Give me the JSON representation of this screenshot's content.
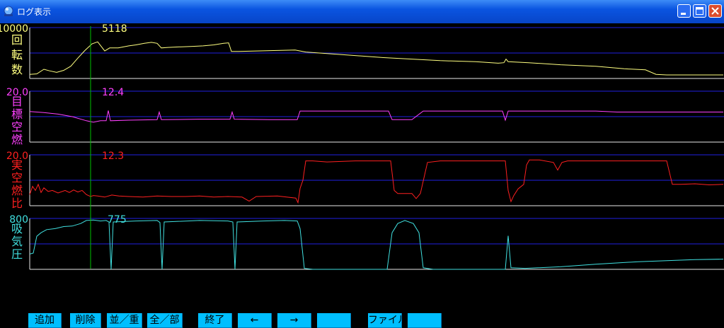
{
  "window": {
    "title": "ログ表示",
    "controls": [
      "minimize",
      "maximize",
      "close"
    ]
  },
  "panels": [
    {
      "max_label": "10000",
      "caption": [
        "回",
        "転",
        "数"
      ],
      "cursor_value": "5118",
      "color": "#ffff80",
      "data": [
        [
          0,
          8
        ],
        [
          10,
          9
        ],
        [
          20,
          18
        ],
        [
          28,
          15
        ],
        [
          38,
          12
        ],
        [
          48,
          16
        ],
        [
          58,
          24
        ],
        [
          68,
          40
        ],
        [
          78,
          55
        ],
        [
          88,
          68
        ],
        [
          96,
          72
        ],
        [
          106,
          54
        ],
        [
          113,
          60
        ],
        [
          125,
          60
        ],
        [
          140,
          64
        ],
        [
          150,
          66
        ],
        [
          162,
          69
        ],
        [
          172,
          71
        ],
        [
          180,
          69
        ],
        [
          186,
          60
        ],
        [
          195,
          61
        ],
        [
          210,
          62
        ],
        [
          230,
          63
        ],
        [
          245,
          64
        ],
        [
          260,
          66
        ],
        [
          274,
          69
        ],
        [
          281,
          70
        ],
        [
          285,
          53
        ],
        [
          295,
          53
        ],
        [
          320,
          54
        ],
        [
          350,
          55
        ],
        [
          375,
          56
        ],
        [
          390,
          52
        ],
        [
          420,
          49
        ],
        [
          460,
          45
        ],
        [
          500,
          41
        ],
        [
          540,
          38
        ],
        [
          580,
          35
        ],
        [
          630,
          33
        ],
        [
          662,
          30
        ],
        [
          670,
          31
        ],
        [
          673,
          38
        ],
        [
          676,
          33
        ],
        [
          705,
          31
        ],
        [
          750,
          27
        ],
        [
          800,
          24
        ],
        [
          840,
          19
        ],
        [
          870,
          17
        ],
        [
          885,
          8
        ],
        [
          900,
          7
        ],
        [
          960,
          7
        ],
        [
          980,
          7
        ]
      ]
    },
    {
      "max_label": "20.0",
      "caption": [
        "目",
        "標",
        "空",
        "燃"
      ],
      "cursor_value": "12.4",
      "color": "#ff40ff",
      "data": [
        [
          0,
          60
        ],
        [
          20,
          58
        ],
        [
          40,
          55
        ],
        [
          60,
          50
        ],
        [
          80,
          42
        ],
        [
          90,
          39
        ],
        [
          100,
          42
        ],
        [
          108,
          42
        ],
        [
          111,
          62
        ],
        [
          114,
          42
        ],
        [
          140,
          43
        ],
        [
          180,
          44
        ],
        [
          183,
          59
        ],
        [
          186,
          44
        ],
        [
          240,
          45
        ],
        [
          283,
          45
        ],
        [
          286,
          59
        ],
        [
          289,
          45
        ],
        [
          340,
          44
        ],
        [
          378,
          44
        ],
        [
          382,
          61
        ],
        [
          400,
          61
        ],
        [
          480,
          61
        ],
        [
          507,
          61
        ],
        [
          512,
          44
        ],
        [
          540,
          44
        ],
        [
          556,
          61
        ],
        [
          620,
          61
        ],
        [
          668,
          61
        ],
        [
          672,
          43
        ],
        [
          676,
          61
        ],
        [
          800,
          61
        ],
        [
          830,
          59
        ],
        [
          900,
          59
        ],
        [
          980,
          59
        ]
      ]
    },
    {
      "max_label": "20.0",
      "caption": [
        "実",
        "空",
        "燃",
        "比"
      ],
      "cursor_value": "12.3",
      "color": "#ff2020",
      "data": [
        [
          0,
          22
        ],
        [
          4,
          38
        ],
        [
          8,
          30
        ],
        [
          12,
          42
        ],
        [
          16,
          26
        ],
        [
          20,
          35
        ],
        [
          26,
          28
        ],
        [
          32,
          30
        ],
        [
          40,
          25
        ],
        [
          50,
          30
        ],
        [
          56,
          26
        ],
        [
          62,
          31
        ],
        [
          68,
          27
        ],
        [
          74,
          30
        ],
        [
          80,
          22
        ],
        [
          86,
          18
        ],
        [
          90,
          20
        ],
        [
          96,
          19
        ],
        [
          106,
          17
        ],
        [
          116,
          21
        ],
        [
          126,
          19
        ],
        [
          140,
          18
        ],
        [
          160,
          17
        ],
        [
          180,
          19
        ],
        [
          200,
          18
        ],
        [
          220,
          18
        ],
        [
          240,
          19
        ],
        [
          260,
          17
        ],
        [
          280,
          18
        ],
        [
          300,
          17
        ],
        [
          310,
          9
        ],
        [
          320,
          18
        ],
        [
          350,
          19
        ],
        [
          376,
          15
        ],
        [
          379,
          6
        ],
        [
          382,
          34
        ],
        [
          386,
          50
        ],
        [
          390,
          88
        ],
        [
          400,
          88
        ],
        [
          420,
          86
        ],
        [
          440,
          87
        ],
        [
          460,
          88
        ],
        [
          490,
          88
        ],
        [
          510,
          88
        ],
        [
          515,
          30
        ],
        [
          520,
          24
        ],
        [
          530,
          24
        ],
        [
          540,
          24
        ],
        [
          546,
          14
        ],
        [
          552,
          24
        ],
        [
          562,
          85
        ],
        [
          580,
          88
        ],
        [
          600,
          88
        ],
        [
          620,
          88
        ],
        [
          640,
          88
        ],
        [
          660,
          88
        ],
        [
          672,
          88
        ],
        [
          676,
          30
        ],
        [
          680,
          8
        ],
        [
          684,
          20
        ],
        [
          690,
          33
        ],
        [
          698,
          42
        ],
        [
          702,
          80
        ],
        [
          706,
          90
        ],
        [
          720,
          90
        ],
        [
          740,
          85
        ],
        [
          746,
          70
        ],
        [
          752,
          85
        ],
        [
          760,
          88
        ],
        [
          800,
          88
        ],
        [
          840,
          88
        ],
        [
          880,
          88
        ],
        [
          900,
          88
        ],
        [
          908,
          42
        ],
        [
          920,
          42
        ],
        [
          940,
          43
        ],
        [
          960,
          41
        ],
        [
          980,
          42
        ]
      ]
    },
    {
      "max_label": "800",
      "caption": [
        "吸",
        "気",
        "圧"
      ],
      "cursor_value": "775",
      "color": "#40e0e0",
      "data": [
        [
          0,
          30
        ],
        [
          5,
          32
        ],
        [
          10,
          65
        ],
        [
          16,
          72
        ],
        [
          24,
          78
        ],
        [
          36,
          80
        ],
        [
          48,
          84
        ],
        [
          60,
          85
        ],
        [
          72,
          90
        ],
        [
          80,
          96
        ],
        [
          90,
          97
        ],
        [
          100,
          95
        ],
        [
          108,
          96
        ],
        [
          112,
          93
        ],
        [
          115,
          0
        ],
        [
          118,
          93
        ],
        [
          150,
          95
        ],
        [
          180,
          96
        ],
        [
          184,
          92
        ],
        [
          187,
          0
        ],
        [
          190,
          93
        ],
        [
          240,
          96
        ],
        [
          280,
          95
        ],
        [
          287,
          93
        ],
        [
          290,
          0
        ],
        [
          293,
          93
        ],
        [
          330,
          95
        ],
        [
          360,
          96
        ],
        [
          378,
          95
        ],
        [
          382,
          80
        ],
        [
          388,
          2
        ],
        [
          400,
          0
        ],
        [
          450,
          0
        ],
        [
          505,
          0
        ],
        [
          512,
          72
        ],
        [
          520,
          90
        ],
        [
          530,
          96
        ],
        [
          542,
          90
        ],
        [
          550,
          72
        ],
        [
          556,
          3
        ],
        [
          570,
          0
        ],
        [
          620,
          0
        ],
        [
          672,
          0
        ],
        [
          676,
          66
        ],
        [
          680,
          3
        ],
        [
          700,
          2
        ],
        [
          750,
          5
        ],
        [
          800,
          10
        ],
        [
          860,
          15
        ],
        [
          900,
          17
        ],
        [
          940,
          19
        ],
        [
          980,
          20
        ]
      ]
    }
  ],
  "buttons": [
    "追加",
    "削除",
    "並／重",
    "全／部",
    "終了",
    "←",
    "→",
    "",
    "ファイル",
    ""
  ]
}
